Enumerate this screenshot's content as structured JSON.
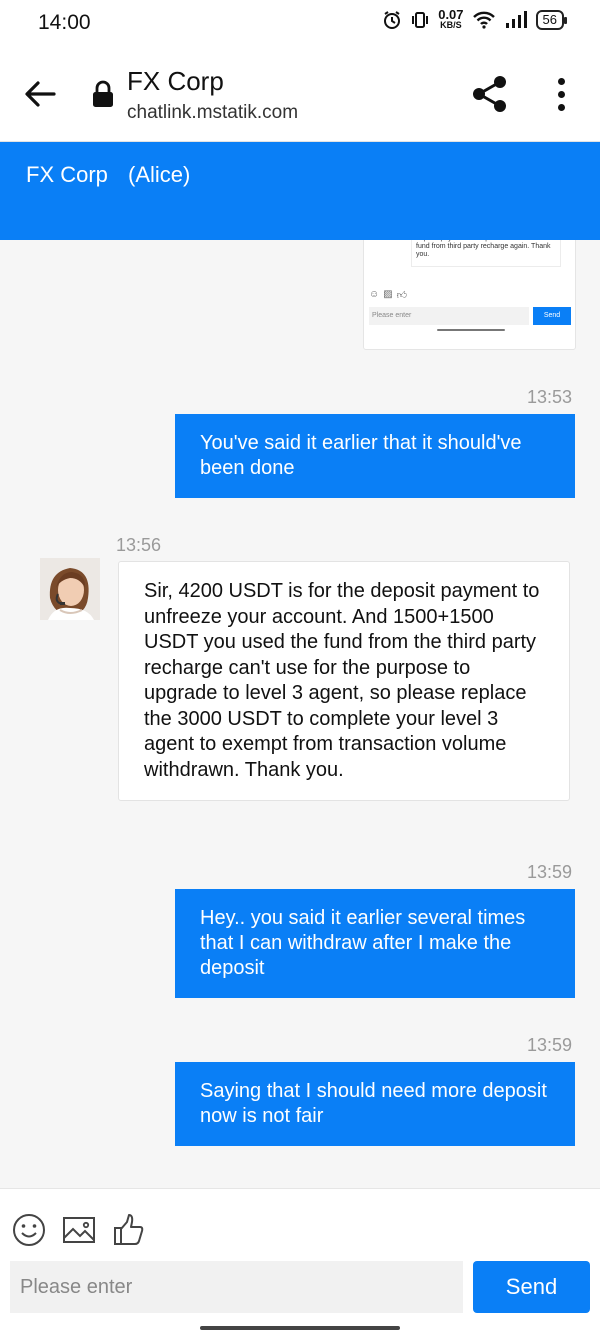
{
  "status_bar": {
    "time": "14:00",
    "net_speed_value": "0.07",
    "net_speed_unit": "KB/S",
    "battery": "56",
    "icons": [
      "alarm-icon",
      "vibrate-icon",
      "wifi-icon",
      "signal-icon",
      "battery-icon"
    ]
  },
  "browser": {
    "title": "FX Corp",
    "url": "chatlink.mstatik.com"
  },
  "chat_header": {
    "title": "FX Corp",
    "agent": "(Alice)",
    "accent": "#0a7ff6"
  },
  "screenshot_preview": {
    "message_text": "Yes sir, you can resume normal currency withdraw after you have completed the deposit payment. And please DON'T use the fund from third party recharge again. Thank you.",
    "input_placeholder": "Please enter",
    "send_label": "Send"
  },
  "messages": [
    {
      "sender": "user",
      "time": "13:53",
      "text": "You've said it earlier that it should've been done"
    },
    {
      "sender": "agent",
      "time": "13:56",
      "text": "Sir, 4200 USDT is for the deposit payment to unfreeze your account. And 1500+1500 USDT you used the fund from the third party recharge can't use for the purpose to upgrade to level 3 agent, so please replace the 3000 USDT to complete your level 3 agent to exempt from transaction volume withdrawn. Thank you."
    },
    {
      "sender": "user",
      "time": "13:59",
      "text": "Hey.. you said it earlier several times that I can withdraw after I make the deposit"
    },
    {
      "sender": "user",
      "time": "13:59",
      "text": "Saying that I should need more deposit now is not fair"
    }
  ],
  "footer": {
    "input_placeholder": "Please enter",
    "send_label": "Send",
    "tools": [
      "emoji-icon",
      "image-icon",
      "thumbs-up-icon"
    ]
  }
}
